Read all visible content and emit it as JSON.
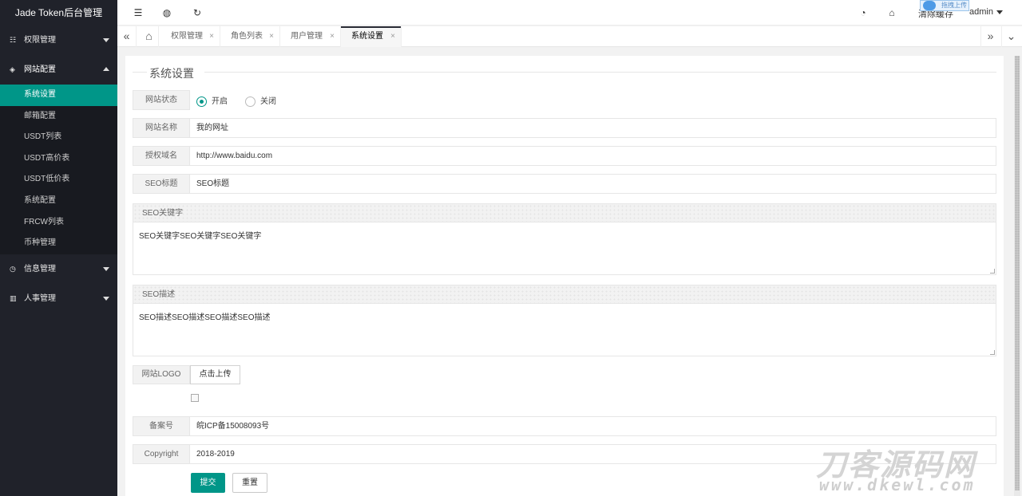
{
  "app": {
    "title": "Jade Token后台管理"
  },
  "sidebar": {
    "items": [
      {
        "label": "权限管理",
        "icon": "user-group-icon",
        "open": false
      },
      {
        "label": "网站配置",
        "icon": "cube-icon",
        "open": true
      },
      {
        "label": "信息管理",
        "icon": "clock-icon",
        "open": false
      },
      {
        "label": "人事管理",
        "icon": "chart-icon",
        "open": false
      }
    ],
    "sub_items": [
      "系统设置",
      "邮箱配置",
      "USDT列表",
      "USDT高价表",
      "USDT低价表",
      "系统配置",
      "FRCW列表",
      "币种管理"
    ],
    "active_sub": "系统设置"
  },
  "header": {
    "icons": [
      "menu-fold-icon",
      "globe-icon",
      "refresh-icon",
      "theme-icon",
      "tag-icon"
    ],
    "clear_cache": "清除缓存",
    "user": "admin",
    "upload_badge": "拖拽上传"
  },
  "tabs": {
    "items": [
      "权限管理",
      "角色列表",
      "用户管理",
      "系统设置"
    ],
    "active": "系统设置",
    "close_glyph": "×"
  },
  "form": {
    "legend": "系统设置",
    "site_status": {
      "label": "网站状态",
      "options": [
        "开启",
        "关闭"
      ],
      "selected": "开启"
    },
    "site_name": {
      "label": "网站名称",
      "value": "我的网址"
    },
    "auth_domain": {
      "label": "授权域名",
      "value": "http://www.baidu.com"
    },
    "seo_title": {
      "label": "SEO标题",
      "value": "SEO标题"
    },
    "seo_keywords": {
      "label": "SEO关键字",
      "value": "SEO关键字SEO关键字SEO关键字"
    },
    "seo_description": {
      "label": "SEO描述",
      "value": "SEO描述SEO描述SEO描述SEO描述"
    },
    "logo": {
      "label": "网站LOGO",
      "button": "点击上传"
    },
    "icp": {
      "label": "备案号",
      "value": "皖ICP备15008093号"
    },
    "copyright": {
      "label": "Copyright",
      "value": "2018-2019"
    },
    "submit": "提交",
    "reset": "重置"
  },
  "watermark": {
    "big": "刀客源码网",
    "small": "www.dkewl.com"
  },
  "colors": {
    "primary": "#009688",
    "sidebar_bg": "#20222a"
  }
}
